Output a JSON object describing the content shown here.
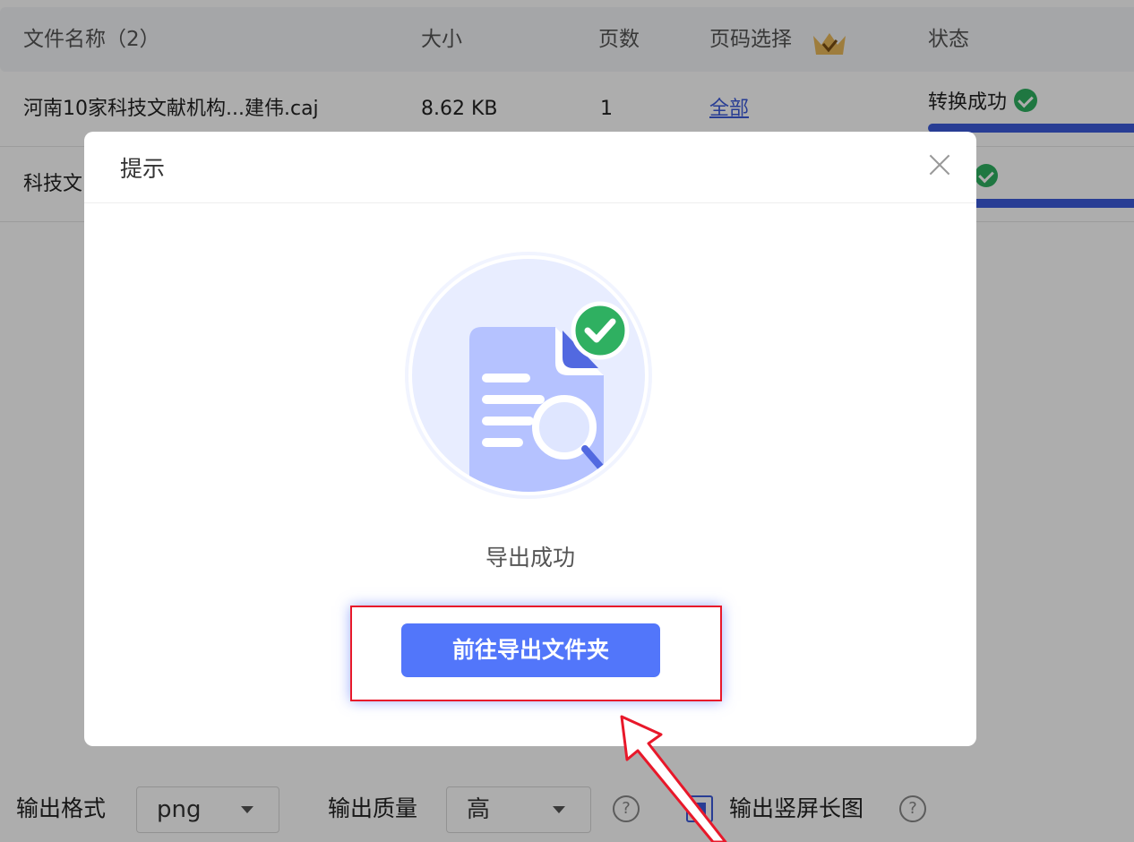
{
  "table": {
    "headers": {
      "filename": "文件名称（2）",
      "size": "大小",
      "pages": "页数",
      "page_select": "页码选择",
      "status": "状态"
    },
    "rows": [
      {
        "filename": "河南10家科技文献机构...建伟.caj",
        "size": "8.62 KB",
        "pages": "1",
        "page_select": "全部",
        "status": "转换成功",
        "progress": 1.0
      },
      {
        "filename": "科技文",
        "status": "成功",
        "progress": 1.0
      }
    ]
  },
  "bottom": {
    "format_label": "输出格式",
    "format_value": "png",
    "quality_label": "输出质量",
    "quality_value": "高",
    "help_glyph": "?",
    "long_image_label": "输出竖屏长图"
  },
  "modal": {
    "title": "提示",
    "message": "导出成功",
    "button_label": "前往导出文件夹"
  },
  "colors": {
    "accent": "#5276fa",
    "link": "#3b5bdb",
    "success": "#2fb061",
    "highlight_border": "#e8182a"
  }
}
